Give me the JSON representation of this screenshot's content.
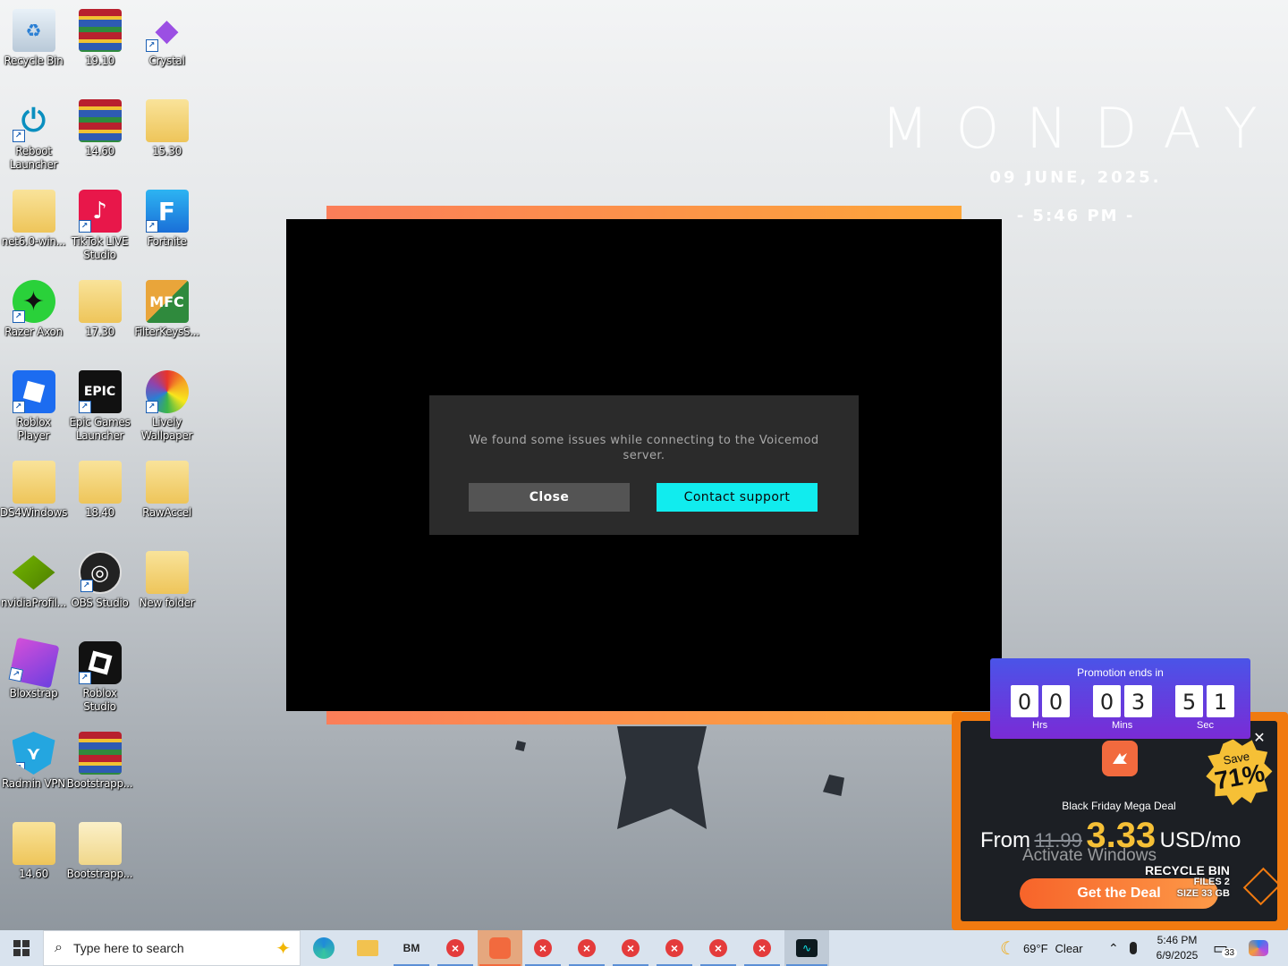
{
  "desktop_icons": [
    {
      "label": "Recycle Bin"
    },
    {
      "label": "19.10"
    },
    {
      "label": "Crystal"
    },
    {
      "label": "Reboot Launcher"
    },
    {
      "label": "14.60"
    },
    {
      "label": "15.30"
    },
    {
      "label": "net6.0-win..."
    },
    {
      "label": "TikTok LIVE Studio"
    },
    {
      "label": "Fortnite"
    },
    {
      "label": "Razer Axon"
    },
    {
      "label": "17.30"
    },
    {
      "label": "FilterKeysS..."
    },
    {
      "label": "Roblox Player"
    },
    {
      "label": "Epic Games Launcher"
    },
    {
      "label": "Lively Wallpaper"
    },
    {
      "label": "DS4Windows"
    },
    {
      "label": "18.40"
    },
    {
      "label": "RawAccel"
    },
    {
      "label": "nvidiaProfil..."
    },
    {
      "label": "OBS Studio"
    },
    {
      "label": "New folder"
    },
    {
      "label": "Bloxstrap"
    },
    {
      "label": "Roblox Studio"
    },
    {
      "label": "Radmin VPN"
    },
    {
      "label": "Bootstrapp..."
    },
    {
      "label": "14.60"
    },
    {
      "label": "Bootstrapp..."
    }
  ],
  "clock_widget": {
    "day": "MONDAY",
    "date": "09 JUNE, 2025.",
    "time": "- 5:46 PM -"
  },
  "voicemod_dialog": {
    "message": "We found some issues while connecting to the Voicemod server.",
    "close_label": "Close",
    "contact_label": "Contact support",
    "accent_color": "#11ecee"
  },
  "promo": {
    "timer_caption": "Promotion ends in",
    "hours": [
      "0",
      "0"
    ],
    "minutes": [
      "0",
      "3"
    ],
    "seconds": [
      "5",
      "1"
    ],
    "hrs_label": "Hrs",
    "mins_label": "Mins",
    "sec_label": "Sec",
    "save_text": "Save",
    "save_percent": "71%",
    "title": "Black Friday Mega Deal",
    "from": "From",
    "old_price": "11.99",
    "new_price": "3.33",
    "per": "USD/mo",
    "button": "Get the Deal",
    "close": "✕"
  },
  "watermark": {
    "activate": "Activate Windows"
  },
  "recycle_overlay": {
    "title": "RECYCLE BIN",
    "files": "FILES 2",
    "size": "SIZE 33 GB"
  },
  "taskbar": {
    "search_placeholder": "Type here to search",
    "weather_temp": "69°F",
    "weather_text": "Clear",
    "time": "5:46 PM",
    "date": "6/9/2025",
    "notification_count": "33"
  }
}
